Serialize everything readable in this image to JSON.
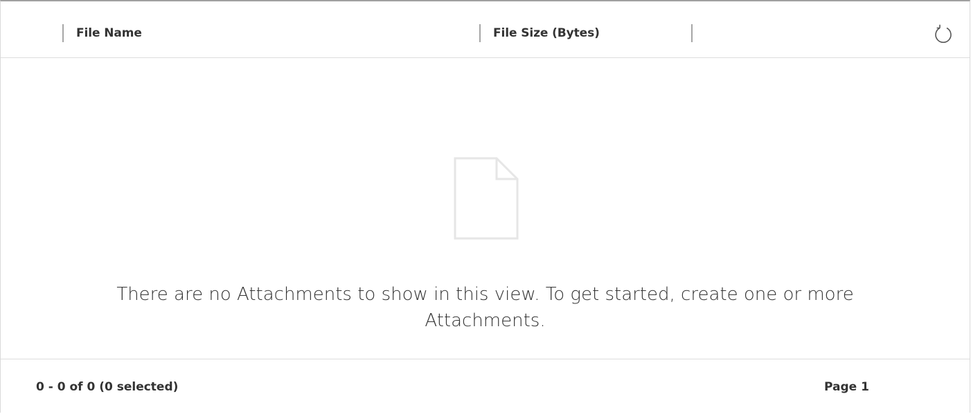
{
  "grid": {
    "columns": [
      {
        "label": "File Name"
      },
      {
        "label": "File Size (Bytes)"
      }
    ],
    "refresh_icon": "refresh-icon",
    "empty_state": {
      "icon": "document-icon",
      "message_line1": "There are no Attachments to show in this view. To get started, create one or more",
      "message_line2": "Attachments."
    },
    "footer": {
      "record_count": "0 - 0 of 0 (0 selected)",
      "page_label": "Page 1"
    }
  },
  "colors": {
    "text": "#333333",
    "separator": "#a6a6a6",
    "border": "#dcdcdc",
    "empty_icon": "#e6e6e6"
  }
}
